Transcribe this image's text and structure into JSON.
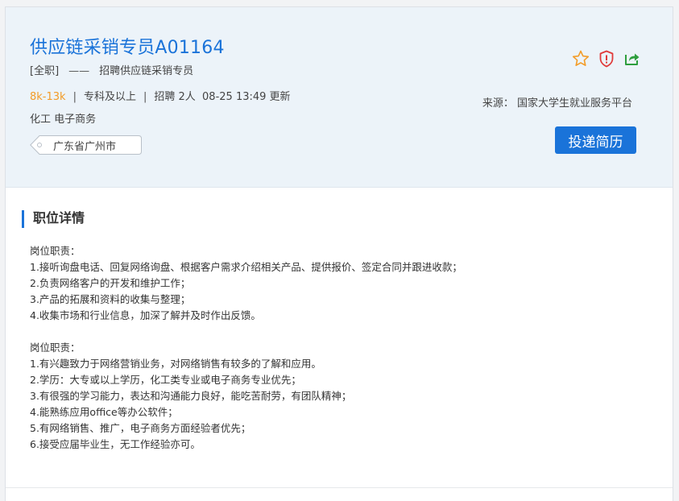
{
  "job": {
    "title": "供应链采销专员A01164",
    "type": "[全职]",
    "dash": "——",
    "recruit_line": "招聘供应链采销专员",
    "salary": "8k-13k",
    "education": "专科及以上",
    "headcount": "招聘 2人",
    "updated": "08-25 13:49 更新",
    "industry": "化工 电子商务",
    "location": "广东省广州市"
  },
  "actions": {
    "source_label": "来源：",
    "source_value": "国家大学生就业服务平台",
    "apply_label": "投递简历",
    "icons": [
      "star-icon",
      "shield-alert-icon",
      "share-icon"
    ]
  },
  "detail": {
    "heading": "职位详情",
    "paragraphs": [
      {
        "title": "岗位职责：",
        "lines": [
          "1.接听询盘电话、回复网络询盘、根据客户需求介绍相关产品、提供报价、签定合同并跟进收款；",
          "2.负责网络客户的开发和维护工作；",
          "3.产品的拓展和资料的收集与整理；",
          "4.收集市场和行业信息，加深了解并及时作出反馈。"
        ]
      },
      {
        "title": "岗位职责：",
        "lines": [
          "1.有兴趣致力于网络营销业务，对网络销售有较多的了解和应用。",
          "2.学历：大专或以上学历，化工类专业或电子商务专业优先；",
          "3.有很强的学习能力，表达和沟通能力良好，能吃苦耐劳，有团队精神；",
          "4.能熟练应用office等办公软件；",
          "5.有网络销售、推广，电子商务方面经验者优先；",
          "6.接受应届毕业生，无工作经验亦可。"
        ]
      }
    ]
  },
  "colors": {
    "accent": "#1a73d9",
    "salary": "#f39c28",
    "star": "#f39c28",
    "shield": "#e03a3a",
    "share": "#2e9e3e",
    "header_bg": "#ecf3f9"
  }
}
